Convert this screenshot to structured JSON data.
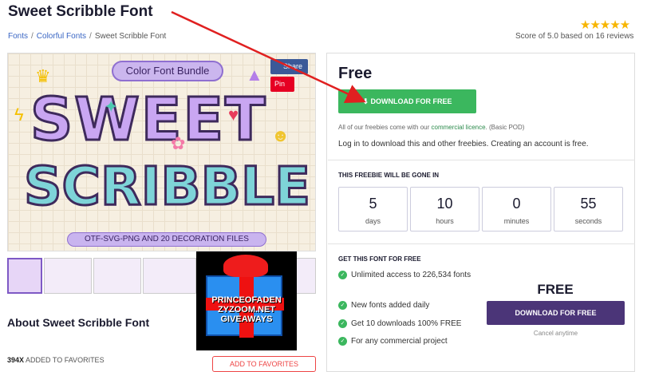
{
  "page": {
    "title": "Sweet Scribble Font"
  },
  "breadcrumb": {
    "items": [
      "Fonts",
      "Colorful Fonts"
    ],
    "current": "Sweet Scribble Font"
  },
  "rating": {
    "stars": "★★★★★",
    "score_text": "Score of 5.0 based on 16 reviews"
  },
  "hero": {
    "bundle_label": "Color Font Bundle",
    "headline_1": "SWEET",
    "headline_2": "SCRIBBLE",
    "files_label": "OTF-SVG-PNG AND 20 DECORATION FILES",
    "share_label": "Share",
    "pin_label": "Pin"
  },
  "giveaway": {
    "line1": "PRINCEOFADEN",
    "line2": "ZYZOOM.NET",
    "line3": "GIVEAWAYS"
  },
  "about": {
    "heading": "About Sweet Scribble Font",
    "favorites_count": "394X",
    "favorites_text": "ADDED TO FAVORITES",
    "add_button": "ADD TO FAVORITES"
  },
  "panel": {
    "price": "Free",
    "download_label": "DOWNLOAD FOR FREE",
    "note_prefix": "All of our freebies come with our",
    "note_link": "commercial licence",
    "note_suffix": ". (Basic POD)",
    "login_text": "Log in to download this and other freebies. Creating an account is free.",
    "countdown_title": "THIS FREEBIE WILL BE GONE IN",
    "countdown": [
      {
        "value": "5",
        "unit": "days"
      },
      {
        "value": "10",
        "unit": "hours"
      },
      {
        "value": "0",
        "unit": "minutes"
      },
      {
        "value": "55",
        "unit": "seconds"
      }
    ],
    "get_title": "GET THIS FONT FOR FREE",
    "features": [
      "Unlimited access to 226,534 fonts",
      "New fonts added daily",
      "Get 10 downloads 100% FREE",
      "For any commercial project"
    ],
    "free_big": "FREE",
    "download2_label": "DOWNLOAD FOR FREE",
    "cancel_text": "Cancel anytime"
  },
  "colors": {
    "green": "#3bb75e",
    "purple": "#4b3578",
    "annotation_red": "#e02020",
    "star": "#f7b500"
  }
}
